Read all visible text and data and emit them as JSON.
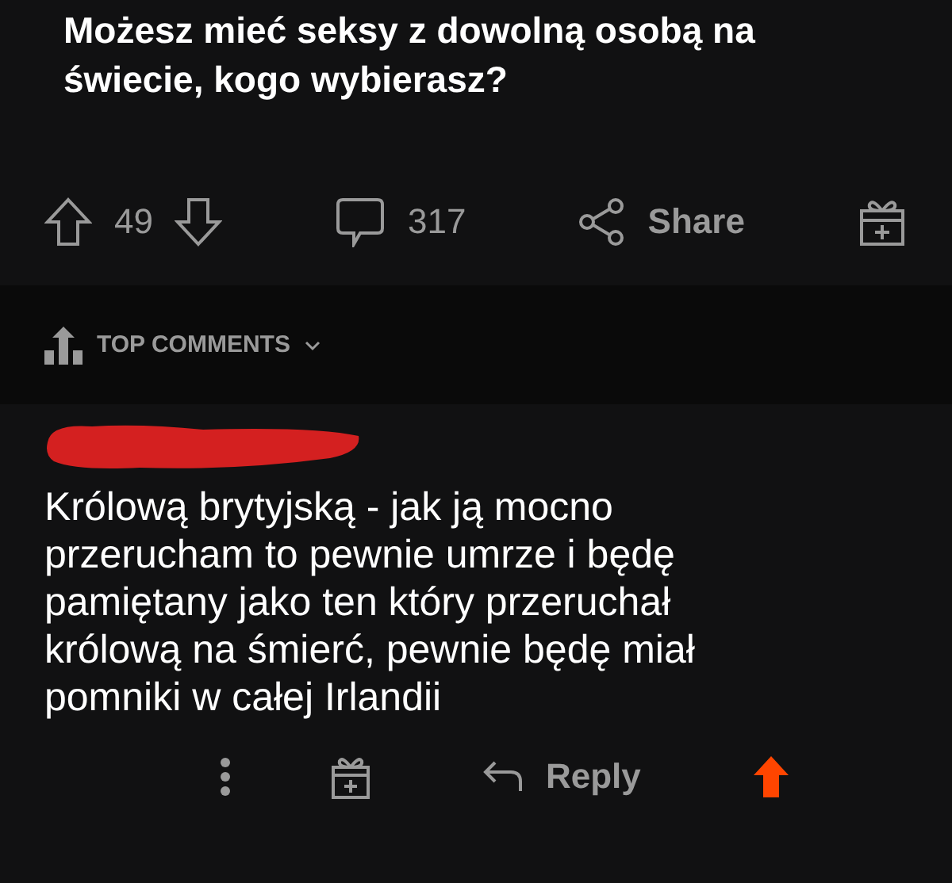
{
  "post": {
    "title": "Możesz mieć seksy z dowolną osobą na świecie, kogo wybierasz?"
  },
  "actions": {
    "upvotes": "49",
    "comments": "317",
    "share": "Share"
  },
  "sort": {
    "label": "TOP COMMENTS"
  },
  "comment": {
    "text": "Królową brytyjską - jak ją mocno przerucham to pewnie umrze i będę pamiętany jako ten który przeruchał królową na śmierć, pewnie będę miał pomniki w całej Irlandii",
    "reply": "Reply"
  }
}
